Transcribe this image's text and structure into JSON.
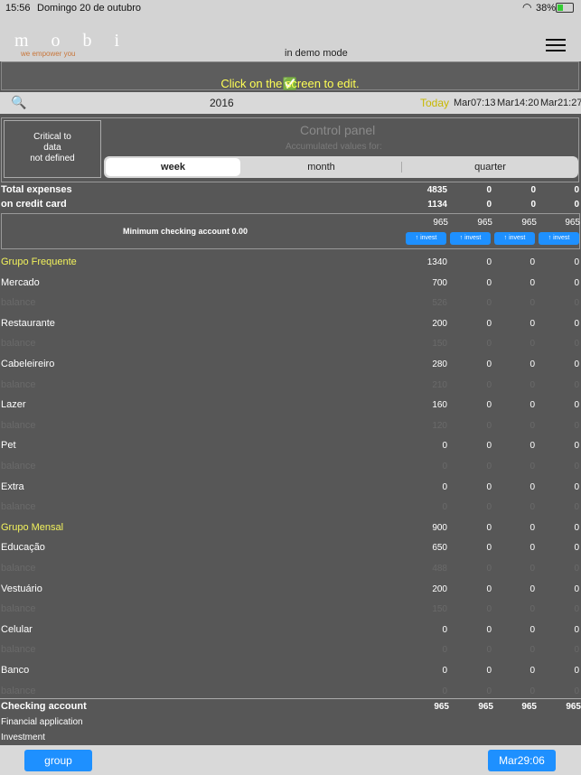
{
  "status": {
    "time": "15:56",
    "date": "Domingo 20 de outubro",
    "battery": "38%"
  },
  "header": {
    "logo": "m o b i",
    "tagline": "we empower you",
    "mode": "in demo mode"
  },
  "banner": {
    "check": "✅",
    "text": "Click on the screen to edit."
  },
  "yearbar": {
    "year": "2016",
    "today": "Today",
    "dates": [
      "Mar07:13",
      "Mar14:20",
      "Mar21:27"
    ]
  },
  "panel": {
    "critical": [
      "Critical to",
      "data",
      "not defined"
    ],
    "title": "Control panel",
    "subtitle": "Accumulated values for:",
    "options": [
      "week",
      "month",
      "quarter"
    ]
  },
  "summary": [
    {
      "label": "Total expenses",
      "values": [
        "4835",
        "0",
        "0",
        "0"
      ]
    },
    {
      "label": "on credit card",
      "values": [
        "1134",
        "0",
        "0",
        "0"
      ]
    }
  ],
  "minimum": {
    "label": "Minimum checking account 0.00",
    "values": [
      "965",
      "965",
      "965",
      "965"
    ],
    "invest": "↑ invest"
  },
  "rows": [
    {
      "label": "Grupo Frequente",
      "values": [
        "1340",
        "0",
        "0",
        "0"
      ],
      "kind": "group"
    },
    {
      "label": "Mercado",
      "values": [
        "700",
        "0",
        "0",
        "0"
      ],
      "kind": "item"
    },
    {
      "label": "balance",
      "values": [
        "526",
        "0",
        "0",
        "0"
      ],
      "kind": "balance"
    },
    {
      "label": "Restaurante",
      "values": [
        "200",
        "0",
        "0",
        "0"
      ],
      "kind": "item"
    },
    {
      "label": "balance",
      "values": [
        "150",
        "0",
        "0",
        "0"
      ],
      "kind": "balance"
    },
    {
      "label": "Cabeleireiro",
      "values": [
        "280",
        "0",
        "0",
        "0"
      ],
      "kind": "item"
    },
    {
      "label": "balance",
      "values": [
        "210",
        "0",
        "0",
        "0"
      ],
      "kind": "balance"
    },
    {
      "label": "Lazer",
      "values": [
        "160",
        "0",
        "0",
        "0"
      ],
      "kind": "item"
    },
    {
      "label": "balance",
      "values": [
        "120",
        "0",
        "0",
        "0"
      ],
      "kind": "balance"
    },
    {
      "label": "Pet",
      "values": [
        "0",
        "0",
        "0",
        "0"
      ],
      "kind": "item"
    },
    {
      "label": "balance",
      "values": [
        "0",
        "0",
        "0",
        "0"
      ],
      "kind": "balance"
    },
    {
      "label": "Extra",
      "values": [
        "0",
        "0",
        "0",
        "0"
      ],
      "kind": "item"
    },
    {
      "label": "balance",
      "values": [
        "0",
        "0",
        "0",
        "0"
      ],
      "kind": "balance"
    },
    {
      "label": "Grupo Mensal",
      "values": [
        "900",
        "0",
        "0",
        "0"
      ],
      "kind": "group"
    },
    {
      "label": "Educação",
      "values": [
        "650",
        "0",
        "0",
        "0"
      ],
      "kind": "item"
    },
    {
      "label": "balance",
      "values": [
        "488",
        "0",
        "0",
        "0"
      ],
      "kind": "balance"
    },
    {
      "label": "Vestuário",
      "values": [
        "200",
        "0",
        "0",
        "0"
      ],
      "kind": "item"
    },
    {
      "label": "balance",
      "values": [
        "150",
        "0",
        "0",
        "0"
      ],
      "kind": "balance"
    },
    {
      "label": "Celular",
      "values": [
        "0",
        "0",
        "0",
        "0"
      ],
      "kind": "item"
    },
    {
      "label": "balance",
      "values": [
        "0",
        "0",
        "0",
        "0"
      ],
      "kind": "balance"
    },
    {
      "label": "Banco",
      "values": [
        "0",
        "0",
        "0",
        "0"
      ],
      "kind": "item"
    },
    {
      "label": "balance",
      "values": [
        "0",
        "0",
        "0",
        "0"
      ],
      "kind": "balance"
    }
  ],
  "checking": {
    "label": "Checking account",
    "values": [
      "965",
      "965",
      "965",
      "965"
    ]
  },
  "financial": "Financial application",
  "investment": "Investment",
  "footer": {
    "group": "group",
    "date": "Mar29:06"
  },
  "colors": {
    "accent": "#1e90ff",
    "group": "#f2f25c",
    "today": "#e6d800"
  }
}
